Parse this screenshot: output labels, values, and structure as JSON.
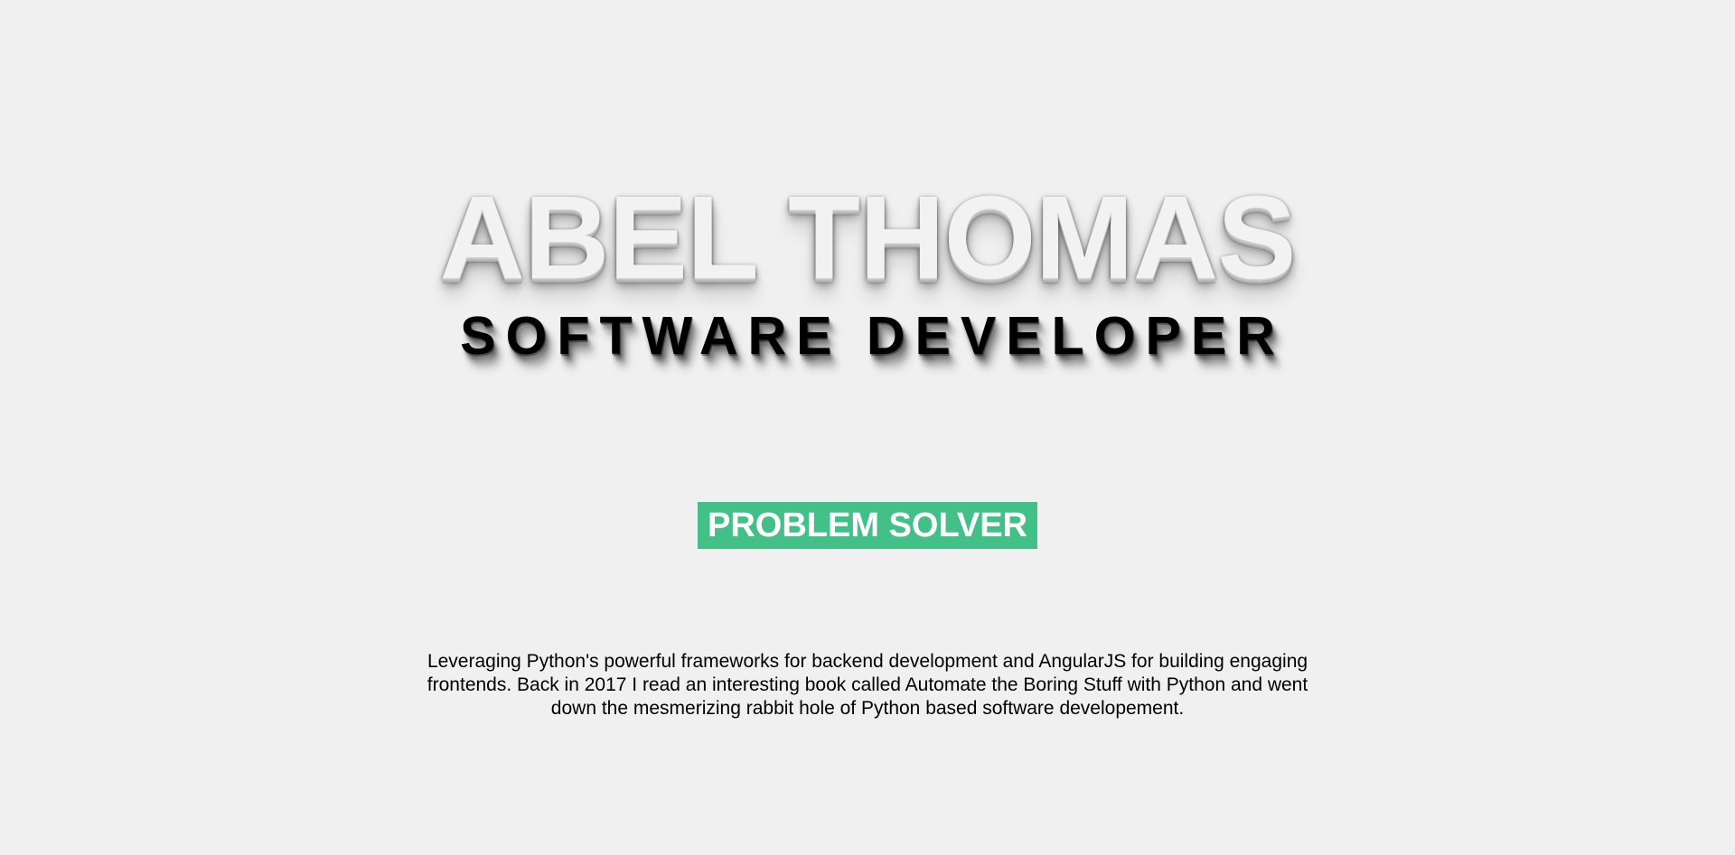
{
  "hero": {
    "name": "ABEL THOMAS",
    "title": "SOFTWARE DEVELOPER",
    "tag": "PROBLEM SOLVER"
  },
  "about": {
    "text": "Leveraging Python's powerful frameworks for backend development and AngularJS for building engaging frontends. Back in 2017 I read an interesting book called Automate the Boring Stuff with Python and went down the mesmerizing rabbit hole of Python based software developement."
  },
  "colors": {
    "background": "#f0f0f0",
    "accent": "#43c088",
    "name_text": "#f3f2f2",
    "title_text": "#000000"
  }
}
